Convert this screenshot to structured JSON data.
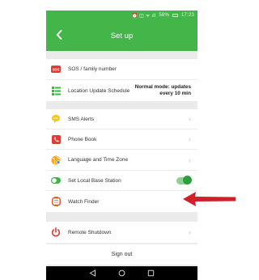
{
  "status_bar": {
    "icons": "⏰ ◫ ᯤ ıll",
    "battery": "58%",
    "time": "17:23"
  },
  "header": {
    "title": "Set up"
  },
  "group1": {
    "sos": {
      "label": "SOS / family number",
      "icon": "sos-icon"
    },
    "location": {
      "label": "Location Update Schedule",
      "note": "Normal mode: updates every 10 min",
      "icon": "schedule-icon"
    }
  },
  "group2": {
    "sms": {
      "label": "SMS Alerts",
      "icon": "chat-bubble-icon"
    },
    "phonebook": {
      "label": "Phone Book",
      "icon": "phonebook-icon"
    },
    "language": {
      "label": "Language and Time Zone",
      "icon": "globe-icon"
    },
    "base_station": {
      "label": "Set Local Base Station",
      "icon": "toggle-icon",
      "enabled": true
    },
    "watch_finder": {
      "label": "Watch Finder",
      "icon": "watch-icon"
    }
  },
  "group3": {
    "shutdown": {
      "label": "Remote Shutdown",
      "icon": "power-icon"
    },
    "signout": {
      "label": "Sign out"
    }
  },
  "colors": {
    "header": "#44b549",
    "arrow": "#d0202a",
    "icon_red": "#e53935",
    "icon_green": "#3fb24a"
  }
}
